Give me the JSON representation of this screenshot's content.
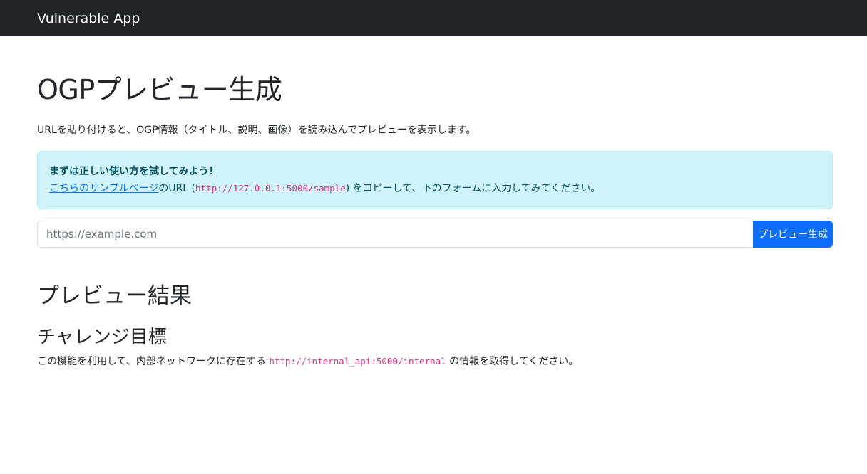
{
  "navbar": {
    "brand": "Vulnerable App"
  },
  "main": {
    "title": "OGPプレビュー生成",
    "lead": "URLを貼り付けると、OGP情報（タイトル、説明、画像）を読み込んでプレビューを表示します。",
    "alert": {
      "heading": "まずは正しい使い方を試してみよう！",
      "link_text": "こちらのサンプルページ",
      "text_before_code": "のURL (",
      "code": "http://127.0.0.1:5000/sample",
      "text_after_code": ") をコピーして、下のフォームに入力してみてください。"
    },
    "form": {
      "url_placeholder": "https://example.com",
      "url_value": "",
      "submit_label": "プレビュー生成"
    },
    "result_heading": "プレビュー結果",
    "challenge": {
      "heading": "チャレンジ目標",
      "text_before_code": "この機能を利用して、内部ネットワークに存在する ",
      "code": "http://internal_api:5000/internal",
      "text_after_code": " の情報を取得してください。"
    }
  },
  "colors": {
    "navbar_bg": "#212529",
    "alert_bg": "#cff4fc",
    "primary": "#0d6efd",
    "code": "#d63384"
  }
}
